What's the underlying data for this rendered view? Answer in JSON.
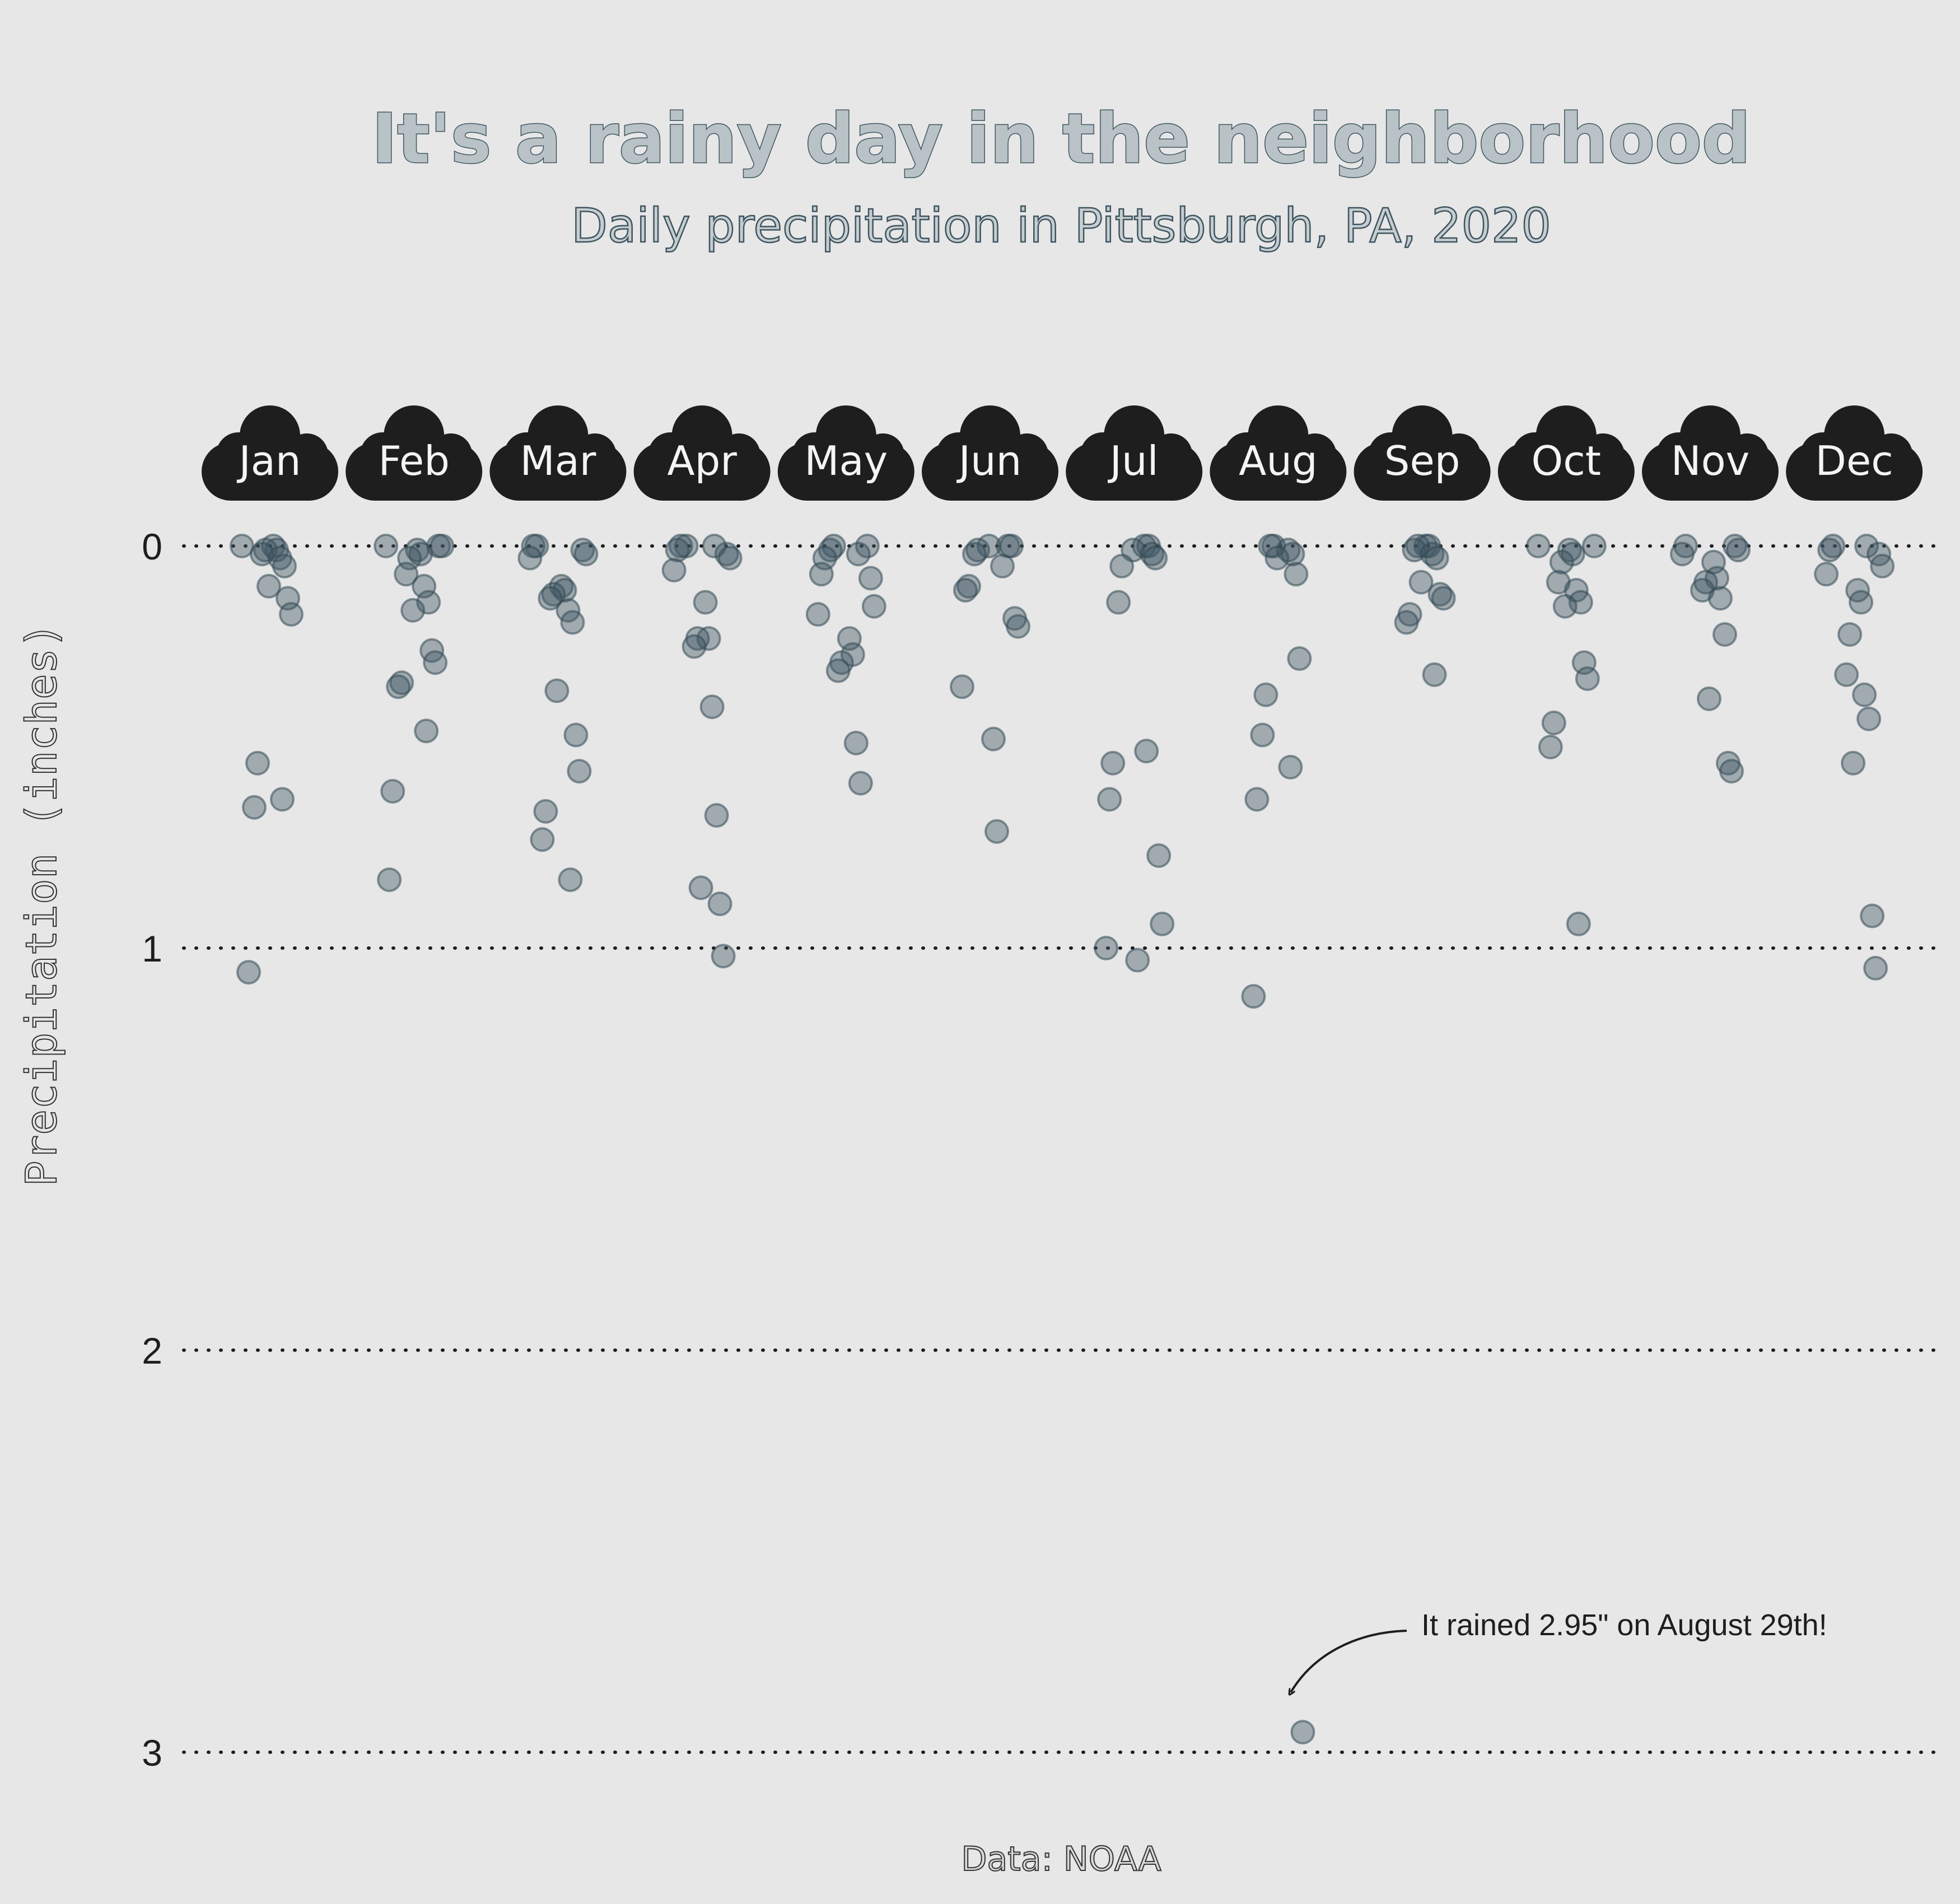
{
  "title": "It's a rainy day in the neighborhood",
  "subtitle": "Daily precipitation in Pittsburgh, PA, 2020",
  "caption": "Data: NOAA",
  "annotation": {
    "text": "It rained 2.95\" on August 29th!"
  },
  "colors": {
    "background": "#e7e7e7",
    "point": "#3e5662",
    "cloud": "#1e1e1e",
    "title": "#3f5560"
  },
  "chart_data": {
    "type": "scatter",
    "title": "It's a rainy day in the neighborhood",
    "subtitle": "Daily precipitation in Pittsburgh, PA, 2020",
    "xlabel": "",
    "ylabel": "Precipitation (inches)",
    "ylim": [
      0,
      3.15
    ],
    "y_reversed": true,
    "y_ticks": [
      0,
      1,
      2,
      3
    ],
    "y_tick_labels": [
      "0",
      "1",
      "2",
      "3"
    ],
    "grid": "horizontal dotted",
    "categories": [
      "Jan",
      "Feb",
      "Mar",
      "Apr",
      "May",
      "Jun",
      "Jul",
      "Aug",
      "Sep",
      "Oct",
      "Nov",
      "Dec"
    ],
    "series": [
      {
        "values": [
          0,
          0,
          0.01,
          0.01,
          0.02,
          0.03,
          0.05,
          0.1,
          0.13,
          0.17,
          0.54,
          0.65,
          0.63,
          1.06
        ]
      },
      {
        "values": [
          0,
          0,
          0,
          0.01,
          0.02,
          0.03,
          0.07,
          0.1,
          0.14,
          0.16,
          0.26,
          0.29,
          0.34,
          0.35,
          0.46,
          0.61,
          0.83
        ]
      },
      {
        "values": [
          0,
          0,
          0.01,
          0.02,
          0.03,
          0.1,
          0.11,
          0.12,
          0.13,
          0.16,
          0.19,
          0.36,
          0.47,
          0.56,
          0.66,
          0.73,
          0.83
        ]
      },
      {
        "values": [
          0,
          0,
          0,
          0.01,
          0.02,
          0.03,
          0.06,
          0.14,
          0.23,
          0.23,
          0.25,
          0.4,
          0.67,
          0.85,
          0.89,
          1.02
        ]
      },
      {
        "values": [
          0,
          0,
          0.01,
          0.02,
          0.03,
          0.07,
          0.08,
          0.15,
          0.17,
          0.23,
          0.27,
          0.29,
          0.31,
          0.49,
          0.59
        ]
      },
      {
        "values": [
          0,
          0,
          0,
          0.01,
          0.02,
          0.05,
          0.1,
          0.11,
          0.18,
          0.2,
          0.35,
          0.48,
          0.71
        ]
      },
      {
        "values": [
          0,
          0,
          0.01,
          0.02,
          0.03,
          0.05,
          0.14,
          0.51,
          0.54,
          0.63,
          0.77,
          0.94,
          1.0,
          1.03
        ]
      },
      {
        "values": [
          0,
          0,
          0.01,
          0.02,
          0.03,
          0.07,
          0.28,
          0.37,
          0.47,
          0.55,
          0.63,
          1.12,
          2.95
        ]
      },
      {
        "values": [
          0,
          0,
          0,
          0.01,
          0.02,
          0.03,
          0.09,
          0.12,
          0.13,
          0.17,
          0.19,
          0.32
        ]
      },
      {
        "values": [
          0,
          0,
          0.01,
          0.02,
          0.04,
          0.09,
          0.11,
          0.14,
          0.15,
          0.29,
          0.33,
          0.44,
          0.5,
          0.94
        ]
      },
      {
        "values": [
          0,
          0,
          0.01,
          0.02,
          0.04,
          0.08,
          0.09,
          0.11,
          0.13,
          0.22,
          0.38,
          0.54,
          0.56
        ]
      },
      {
        "values": [
          0,
          0,
          0.01,
          0.02,
          0.05,
          0.07,
          0.11,
          0.14,
          0.22,
          0.32,
          0.37,
          0.43,
          0.54,
          0.92,
          1.05
        ]
      }
    ],
    "annotations": [
      {
        "text": "It rained 2.95\" on August 29th!",
        "category": "Aug",
        "value": 2.95
      }
    ]
  }
}
